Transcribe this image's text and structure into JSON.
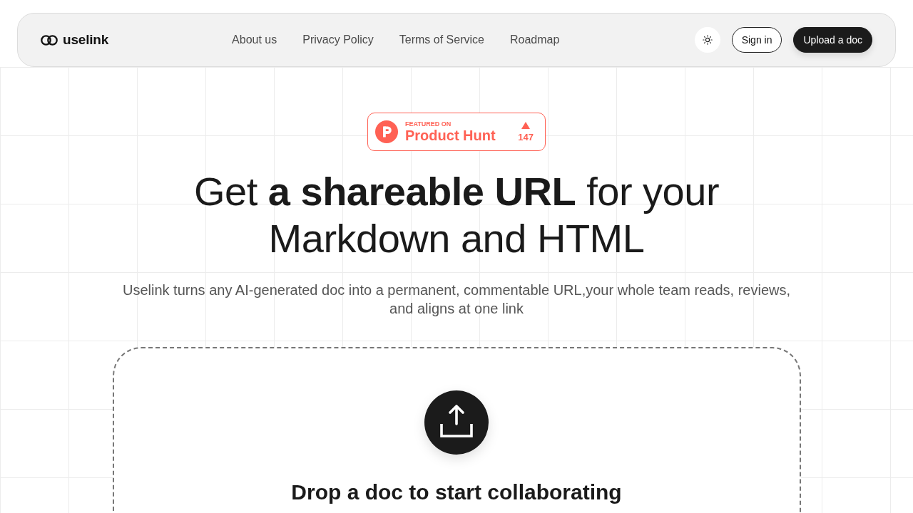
{
  "nav": {
    "logo": "uselink",
    "links": [
      "About us",
      "Privacy Policy",
      "Terms of Service",
      "Roadmap"
    ],
    "buttons": [
      {
        "kind": "outline",
        "label": "Sign in"
      },
      {
        "kind": "primary",
        "label": "Upload a doc"
      }
    ]
  },
  "badge": {
    "featured_label": "FEATURED ON",
    "name": "Product Hunt",
    "votes": "147"
  },
  "hero": {
    "headline": "Get **a shareable URL** for your Markdown and HTML",
    "subtitle": "Uselink turns any AI-generated doc into a permanent, commentable URL,your whole team reads, reviews, and aligns at one link"
  },
  "dropzone": {
    "title": "Drop a doc to start collaborating"
  }
}
